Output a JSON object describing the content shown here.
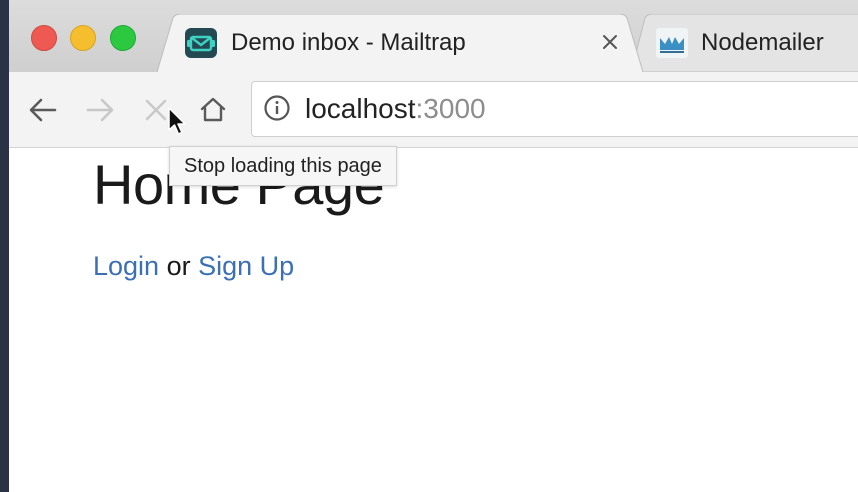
{
  "browser": {
    "tabs": [
      {
        "title": "Demo inbox - Mailtrap",
        "favicon": "mailtrap-logo-icon",
        "active": true
      },
      {
        "title": "Nodemailer",
        "favicon": "nodemailer-logo-icon",
        "active": false
      }
    ],
    "address": {
      "host": "localhost",
      "port": ":3000"
    },
    "tooltip": "Stop loading this page"
  },
  "page": {
    "title": "Home Page",
    "login_link": "Login",
    "connector": "or",
    "signup_link": "Sign Up"
  },
  "colors": {
    "link": "#3b6fb6",
    "traffic_red": "#ee5a52",
    "traffic_yellow": "#f5be2e",
    "traffic_green": "#2bc840"
  }
}
